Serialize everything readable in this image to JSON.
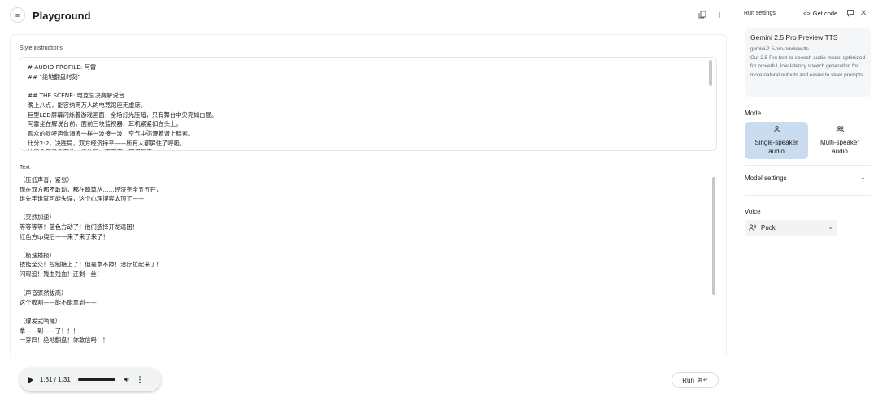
{
  "header": {
    "title": "Playground",
    "menu_icon": "sidebar-toggle-icon",
    "copy_icon": "copy-icon",
    "add_icon": "plus-icon"
  },
  "style_instructions": {
    "label": "Style instructions",
    "text": "# AUDIO PROFILE: 阿雷\n## \"绝地翻盘时刻\"\n\n## THE SCENE: 电竞总决赛解说台\n晚上八点，能容纳两万人的电竞馆座无虚席。\n巨型LED屏幕闪烁着游戏画面，全场灯光压暗，只有舞台中央亮如白昼。\n阿雷坐在解说台前，面前三块监视器，耳机紧紧扣在头上。\n观众的欢呼声像海浪一样一波接一波，空气中弥漫着肾上腺素。\n比分2:2，决胜局，双方经济持平——所有人都屏住了呼吸。\n这是今年最重要的一场比赛，而高潮，即将到来。"
  },
  "text_section": {
    "label": "Text",
    "text": "（压低声音，紧张）\n现在双方都不敢动，都在蹲草丛……经济完全五五开，\n谁先手谁就可能失误，这个心理博弈太顶了——\n\n（突然加速）\n等等等等！蓝色方动了！他们选择开龙逼团！\n红色方tp绕后——来了来了来了！\n\n（极速播报）\n技能全交！控制接上了！但是拿不掉！治疗拉起来了！\n闪现追！残血残血！还剩一丝！\n\n（声音骤然拔高）\n这个收割——能不能拿到——\n\n（爆发式呐喊）\n拿——到——了！！！\n一穿四！绝地翻盘！你敢信吗！！"
  },
  "audio": {
    "time": "1:31 / 1:31",
    "progress": 1.0,
    "play_icon": "play-icon",
    "volume_icon": "volume-icon",
    "more_icon": "more-vert-icon"
  },
  "run_button": {
    "label": "Run",
    "shortcut": "⌘↵"
  },
  "settings_panel": {
    "title": "Run settings",
    "get_code_label": "Get code",
    "model": {
      "name": "Gemini 2.5 Pro Preview TTS",
      "id": "gemini-2.5-pro-preview-tts",
      "description": "Our 2.5 Pro text-to-speech audio model optimized for powerful, low-latency speech generation for more natural outputs and easier to steer prompts."
    },
    "mode": {
      "label": "Mode",
      "single_line1": "Single-speaker",
      "single_line2": "audio",
      "multi_line1": "Multi-speaker",
      "multi_line2": "audio",
      "selected": "single"
    },
    "model_settings_label": "Model settings",
    "voice": {
      "label": "Voice",
      "value": "Puck"
    }
  },
  "colors": {
    "selected_mode_bg": "#c9dcf0",
    "panel_card_bg": "#f5f6f7"
  }
}
